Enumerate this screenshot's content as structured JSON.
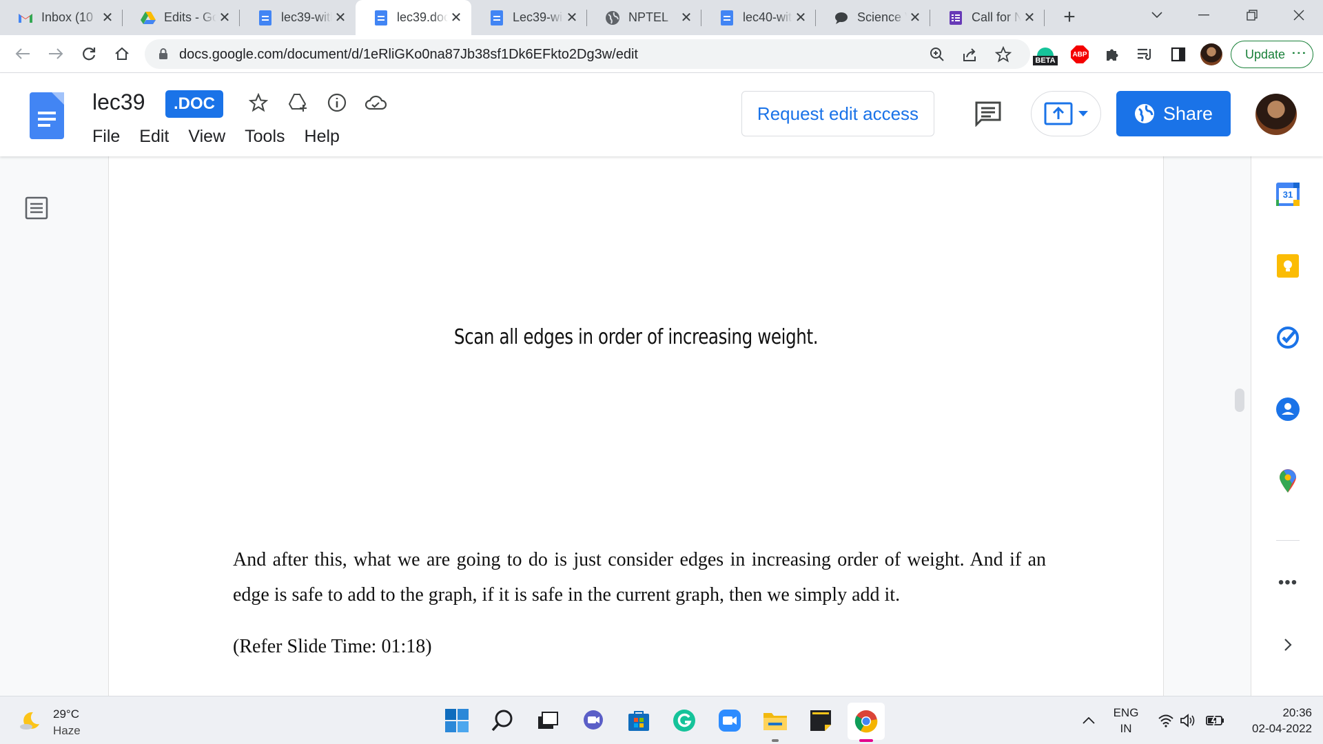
{
  "browser": {
    "tabs": [
      {
        "title": "Inbox (10",
        "icon": "gmail-icon"
      },
      {
        "title": "Edits - Go",
        "icon": "drive-icon"
      },
      {
        "title": "lec39-with",
        "icon": "docs-icon"
      },
      {
        "title": "lec39.doc",
        "icon": "docs-icon",
        "active": true
      },
      {
        "title": "Lec39-wi",
        "icon": "docs-icon"
      },
      {
        "title": "NPTEL",
        "icon": "globe-icon"
      },
      {
        "title": "lec40-wit",
        "icon": "docs-icon"
      },
      {
        "title": "Science V",
        "icon": "chat-icon"
      },
      {
        "title": "Call for N",
        "icon": "forms-icon"
      }
    ],
    "url": "docs.google.com/document/d/1eRliGKo0na87Jb38sf1Dk6EFkto2Dg3w/edit",
    "beta_label": "BETA",
    "abp_label": "ABP",
    "update_label": "Update"
  },
  "docs": {
    "title": "lec39",
    "badge": ".DOC",
    "menu": [
      "File",
      "Edit",
      "View",
      "Tools",
      "Help"
    ],
    "request_edit": "Request edit access",
    "share": "Share",
    "calendar_day": "31"
  },
  "document": {
    "slide_text": "Scan all edges in order of increasing weight.",
    "paragraph": "And after this, what we are going to do is just consider edges in increasing order of weight. And if an edge is safe to add to the graph, if it is safe in the current graph, then we simply add it.",
    "refer": "(Refer Slide Time: 01:18)"
  },
  "taskbar": {
    "temperature": "29°C",
    "weather": "Haze",
    "lang": "ENG",
    "region": "IN",
    "time": "20:36",
    "date": "02-04-2022"
  }
}
